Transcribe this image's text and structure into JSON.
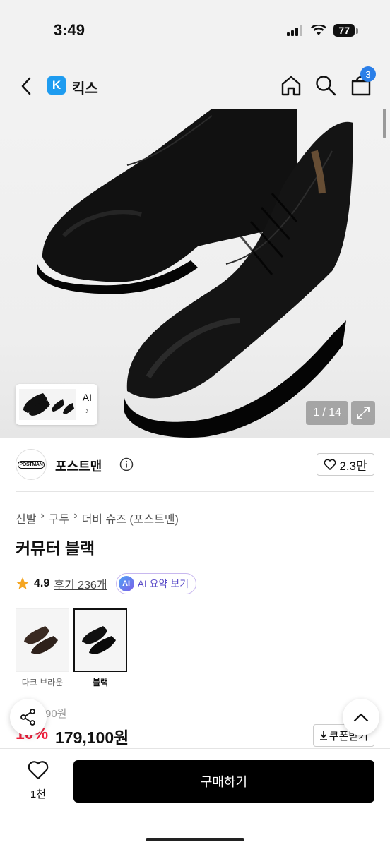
{
  "status_bar": {
    "time": "3:49",
    "battery": "77"
  },
  "app_bar": {
    "brand_logo": "K",
    "brand_name": "킥스",
    "cart_badge": "3"
  },
  "hero": {
    "page_indicator": "1 / 14",
    "ai_thumb_label": "AI",
    "ai_thumb_arrow": "›"
  },
  "brand": {
    "logo_text": "POSTMAN",
    "name": "포스트맨",
    "likes": "2.3만"
  },
  "breadcrumb": [
    "신발",
    "구두",
    "더비 슈즈 (포스트맨)"
  ],
  "breadcrumb_sep": "›",
  "product": {
    "title": "커뮤터 블랙",
    "rating": "4.9",
    "reviews": "후기 236개",
    "ai_badge": "AI",
    "ai_summary": "AI 요약 보기"
  },
  "options": [
    {
      "label": "다크 브라운",
      "color": "#3a2a22"
    },
    {
      "label": "블랙",
      "color": "#111111"
    }
  ],
  "price": {
    "original": "90원",
    "discount": "10%",
    "sale": "179,100원",
    "coupon": "쿠폰받기"
  },
  "bottom_bar": {
    "wish_count": "1천",
    "buy_label": "구매하기"
  },
  "colors": {
    "accent": "#2b7fe8",
    "discount": "#f0213d",
    "brand_logo": "#1e9cf0",
    "star": "#f5a623"
  },
  "icons": [
    "back-chevron-icon",
    "home-icon",
    "search-icon",
    "cart-icon",
    "expand-icon",
    "info-icon",
    "heart-icon",
    "star-icon",
    "share-icon",
    "chevron-up-icon",
    "download-icon"
  ]
}
